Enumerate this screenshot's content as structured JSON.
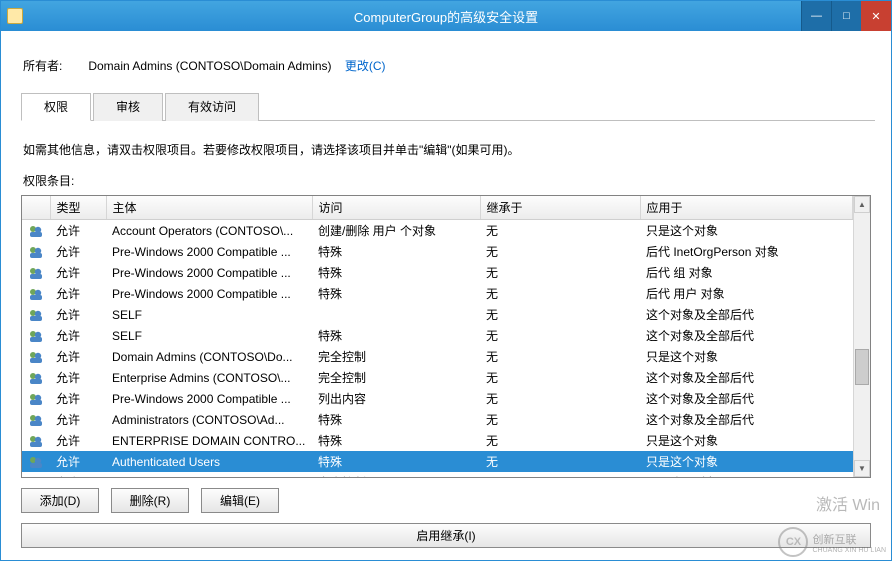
{
  "window": {
    "title": "ComputerGroup的高级安全设置"
  },
  "owner": {
    "label": "所有者:",
    "value": "Domain Admins (CONTOSO\\Domain Admins)",
    "change_link": "更改(C)"
  },
  "tabs": [
    {
      "label": "权限",
      "active": true
    },
    {
      "label": "审核",
      "active": false
    },
    {
      "label": "有效访问",
      "active": false
    }
  ],
  "info_text": "如需其他信息，请双击权限项目。若要修改权限项目，请选择该项目并单击\"编辑\"(如果可用)。",
  "entries_label": "权限条目:",
  "columns": {
    "type": "类型",
    "principal": "主体",
    "access": "访问",
    "inherited": "继承于",
    "applies": "应用于"
  },
  "rows": [
    {
      "type": "允许",
      "principal": "Account Operators (CONTOSO\\...",
      "access": "创建/删除 用户 个对象",
      "inherited": "无",
      "applies": "只是这个对象",
      "selected": false
    },
    {
      "type": "允许",
      "principal": "Pre-Windows 2000 Compatible ...",
      "access": "特殊",
      "inherited": "无",
      "applies": "后代 InetOrgPerson 对象",
      "selected": false
    },
    {
      "type": "允许",
      "principal": "Pre-Windows 2000 Compatible ...",
      "access": "特殊",
      "inherited": "无",
      "applies": "后代 组 对象",
      "selected": false
    },
    {
      "type": "允许",
      "principal": "Pre-Windows 2000 Compatible ...",
      "access": "特殊",
      "inherited": "无",
      "applies": "后代 用户 对象",
      "selected": false
    },
    {
      "type": "允许",
      "principal": "SELF",
      "access": "",
      "inherited": "无",
      "applies": "这个对象及全部后代",
      "selected": false
    },
    {
      "type": "允许",
      "principal": "SELF",
      "access": "特殊",
      "inherited": "无",
      "applies": "这个对象及全部后代",
      "selected": false
    },
    {
      "type": "允许",
      "principal": "Domain Admins (CONTOSO\\Do...",
      "access": "完全控制",
      "inherited": "无",
      "applies": "只是这个对象",
      "selected": false
    },
    {
      "type": "允许",
      "principal": "Enterprise Admins (CONTOSO\\...",
      "access": "完全控制",
      "inherited": "无",
      "applies": "这个对象及全部后代",
      "selected": false
    },
    {
      "type": "允许",
      "principal": "Pre-Windows 2000 Compatible ...",
      "access": "列出内容",
      "inherited": "无",
      "applies": "这个对象及全部后代",
      "selected": false
    },
    {
      "type": "允许",
      "principal": "Administrators (CONTOSO\\Ad...",
      "access": "特殊",
      "inherited": "无",
      "applies": "这个对象及全部后代",
      "selected": false
    },
    {
      "type": "允许",
      "principal": "ENTERPRISE DOMAIN CONTRO...",
      "access": "特殊",
      "inherited": "无",
      "applies": "只是这个对象",
      "selected": false
    },
    {
      "type": "允许",
      "principal": "Authenticated Users",
      "access": "特殊",
      "inherited": "无",
      "applies": "只是这个对象",
      "selected": true
    },
    {
      "type": "允许",
      "principal": "SYSTEM",
      "access": "完全控制",
      "inherited": "无",
      "applies": "只是这个对象",
      "selected": false
    }
  ],
  "buttons": {
    "add": "添加(D)",
    "remove": "删除(R)",
    "edit": "编辑(E)",
    "enable_inherit": "启用继承(I)"
  },
  "watermark": "激活 Win",
  "brand": {
    "text1": "创新互联",
    "text2": "CHUANG XIN HU LIAN"
  }
}
